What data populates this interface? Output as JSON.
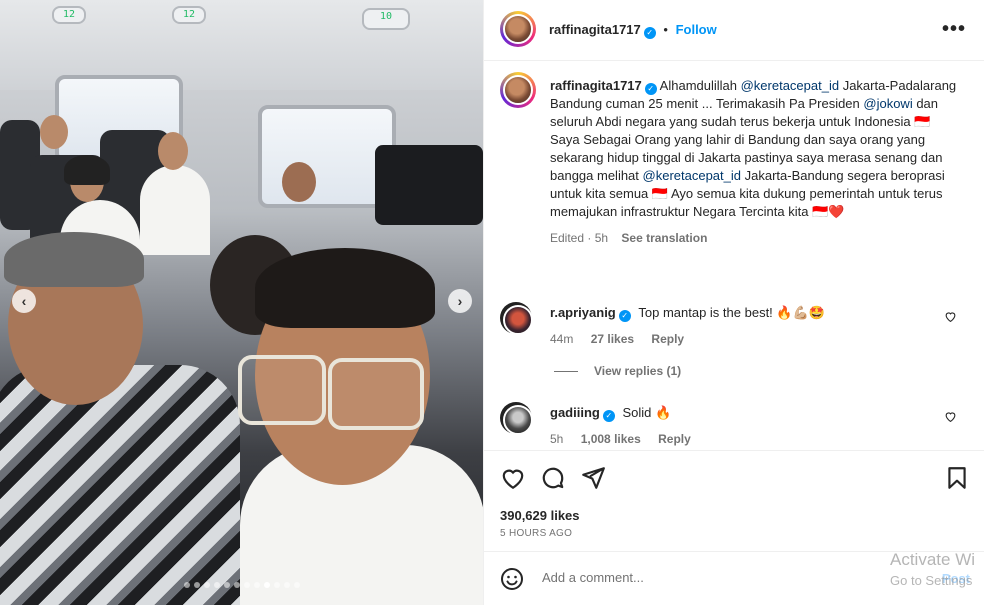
{
  "post": {
    "author": "raffinagita1717",
    "separator": "•",
    "follow_label": "Follow",
    "more_label": "•••"
  },
  "caption": {
    "segments": [
      {
        "t": "text",
        "v": "Alhamdulillah "
      },
      {
        "t": "mention",
        "v": "@keretacepat_id"
      },
      {
        "t": "text",
        "v": " Jakarta-Padalarang Bandung cuman 25 menit ... Terimakasih Pa Presiden "
      },
      {
        "t": "mention",
        "v": "@jokowi"
      },
      {
        "t": "text",
        "v": " dan seluruh Abdi negara yang sudah terus bekerja untuk Indonesia "
      },
      {
        "t": "emoji",
        "v": "🇮🇩"
      },
      {
        "t": "break"
      },
      {
        "t": "text",
        "v": "Saya Sebagai Orang yang lahir di Bandung dan saya orang yang sekarang hidup tinggal di Jakarta pastinya saya merasa senang dan bangga melihat "
      },
      {
        "t": "mention",
        "v": "@keretacepat_id"
      },
      {
        "t": "text",
        "v": " Jakarta-Bandung segera beroprasi untuk kita semua "
      },
      {
        "t": "emoji",
        "v": "🇮🇩"
      },
      {
        "t": "text",
        "v": " Ayo semua kita dukung pemerintah untuk terus memajukan infrastruktur Negara Tercinta kita "
      },
      {
        "t": "emoji",
        "v": "🇮🇩"
      },
      {
        "t": "emoji",
        "v": "❤️"
      }
    ],
    "edited": "Edited · 5h",
    "see_translation": "See translation"
  },
  "comments": [
    {
      "user": "r.apriyanig",
      "text": "Top mantap is the best! 🔥💪🏼🤩",
      "time": "44m",
      "likes": "27 likes",
      "reply": "Reply"
    },
    {
      "user": "gadiiing",
      "text": "Solid 🔥",
      "time": "5h",
      "likes": "1,008 likes",
      "reply": "Reply"
    }
  ],
  "view_replies": "View replies (1)",
  "engagement": {
    "likes": "390,629 likes",
    "time_ago": "5 HOURS AGO"
  },
  "add_comment": {
    "placeholder": "Add a comment...",
    "post_label": "Post"
  },
  "photo_signs": [
    "12",
    "12",
    "10"
  ],
  "watermark": {
    "line1": "Activate Wi",
    "line2": "Go to Settings"
  },
  "carousel": {
    "dots": 12,
    "active_index": 8
  },
  "colors": {
    "accent": "#0095f6",
    "mention": "#00376b",
    "muted": "#737373",
    "heart": "#ed4956"
  }
}
